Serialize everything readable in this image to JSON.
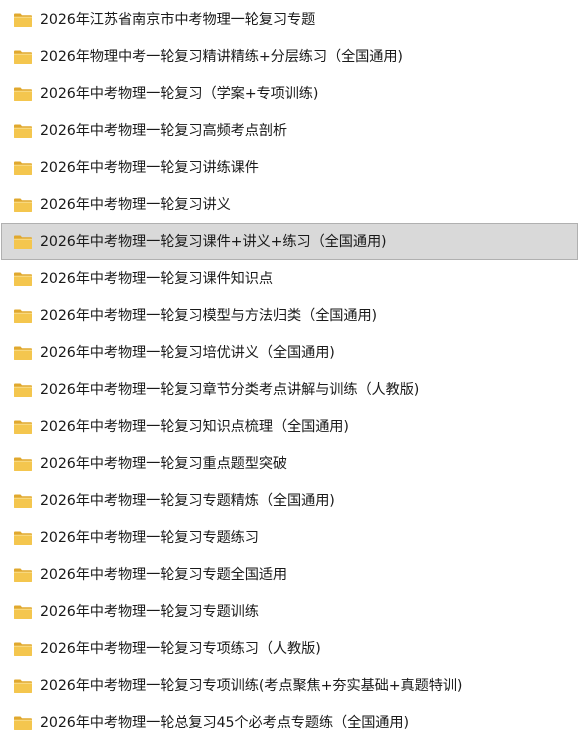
{
  "folders": [
    {
      "name": "2026年江苏省南京市中考物理一轮复习专题",
      "icon": "folder-icon",
      "selected": false
    },
    {
      "name": "2026年物理中考一轮复习精讲精练+分层练习（全国通用)",
      "icon": "folder-icon",
      "selected": false
    },
    {
      "name": "2026年中考物理一轮复习（学案+专项训练)",
      "icon": "folder-icon",
      "selected": false
    },
    {
      "name": "2026年中考物理一轮复习高频考点剖析",
      "icon": "folder-icon",
      "selected": false
    },
    {
      "name": "2026年中考物理一轮复习讲练课件",
      "icon": "folder-icon",
      "selected": false
    },
    {
      "name": "2026年中考物理一轮复习讲义",
      "icon": "folder-icon",
      "selected": false
    },
    {
      "name": "2026年中考物理一轮复习课件+讲义+练习（全国通用)",
      "icon": "folder-icon",
      "selected": true
    },
    {
      "name": "2026年中考物理一轮复习课件知识点",
      "icon": "folder-icon",
      "selected": false
    },
    {
      "name": "2026年中考物理一轮复习模型与方法归类（全国通用)",
      "icon": "folder-icon",
      "selected": false
    },
    {
      "name": "2026年中考物理一轮复习培优讲义（全国通用)",
      "icon": "folder-icon",
      "selected": false
    },
    {
      "name": "2026年中考物理一轮复习章节分类考点讲解与训练（人教版)",
      "icon": "folder-icon",
      "selected": false
    },
    {
      "name": "2026年中考物理一轮复习知识点梳理（全国通用)",
      "icon": "folder-icon",
      "selected": false
    },
    {
      "name": "2026年中考物理一轮复习重点题型突破",
      "icon": "folder-icon",
      "selected": false
    },
    {
      "name": "2026年中考物理一轮复习专题精炼（全国通用)",
      "icon": "folder-icon",
      "selected": false
    },
    {
      "name": "2026年中考物理一轮复习专题练习",
      "icon": "folder-icon",
      "selected": false
    },
    {
      "name": "2026年中考物理一轮复习专题全国适用",
      "icon": "folder-icon",
      "selected": false
    },
    {
      "name": "2026年中考物理一轮复习专题训练",
      "icon": "folder-icon",
      "selected": false
    },
    {
      "name": "2026年中考物理一轮复习专项练习（人教版)",
      "icon": "folder-icon",
      "selected": false
    },
    {
      "name": "2026年中考物理一轮复习专项训练(考点聚焦+夯实基础+真题特训)",
      "icon": "folder-icon",
      "selected": false
    },
    {
      "name": "2026年中考物理一轮总复习45个必考点专题练（全国通用)",
      "icon": "folder-icon",
      "selected": false
    }
  ],
  "colors": {
    "folder_body": "#f4c64e",
    "folder_back": "#e0a82e",
    "selection_bg": "#d9d9d9",
    "selection_border": "#b0b0b0"
  }
}
